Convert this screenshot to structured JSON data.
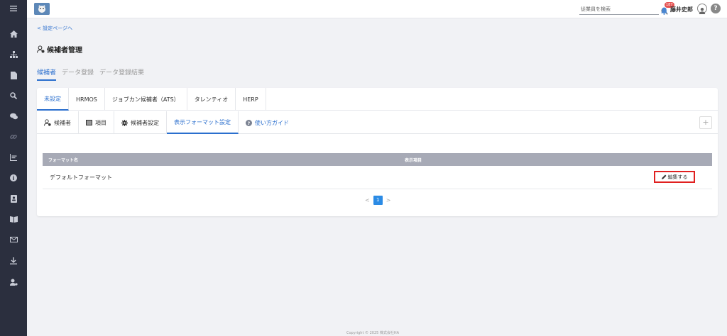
{
  "header": {
    "search_placeholder": "従業員を検索",
    "notification_count": "187",
    "user_name": "藤井史郎",
    "help_label": "?"
  },
  "sidebar": {
    "icons": [
      "home-icon",
      "org-chart-icon",
      "document-icon",
      "search-icon",
      "chat-icon",
      "link-icon",
      "bar-chart-icon",
      "info-icon",
      "contact-card-icon",
      "book-icon",
      "mail-icon",
      "download-icon",
      "user-settings-icon"
    ]
  },
  "page": {
    "back_link": "< 設定ページへ",
    "title": "候補者管理"
  },
  "main_tabs": [
    {
      "label": "候補者"
    },
    {
      "label": "データ登録"
    },
    {
      "label": "データ登録結果"
    }
  ],
  "ats_tabs": [
    {
      "label": "未設定"
    },
    {
      "label": "HRMOS"
    },
    {
      "label": "ジョブカン候補者（ATS）"
    },
    {
      "label": "タレンティオ"
    },
    {
      "label": "HERP"
    }
  ],
  "sub_tabs": [
    {
      "label": "候補者"
    },
    {
      "label": "項目"
    },
    {
      "label": "候補者設定"
    },
    {
      "label": "表示フォーマット設定"
    },
    {
      "label": "使い方ガイド"
    }
  ],
  "plus_label": "+",
  "table": {
    "headers": [
      "フォーマット名",
      "表示項目"
    ],
    "rows": [
      {
        "name": "デフォルトフォーマット",
        "action": "編集する"
      }
    ]
  },
  "pagination": {
    "prev": "<",
    "current": "1",
    "next": ">"
  },
  "footer": {
    "copyright": "Copyright © 2025 株式会社HA"
  },
  "colors": {
    "accent": "#2b6fce",
    "sidebar_bg": "#2b2f3e",
    "highlight_box": "#e02020",
    "table_header": "#a7aab6"
  }
}
